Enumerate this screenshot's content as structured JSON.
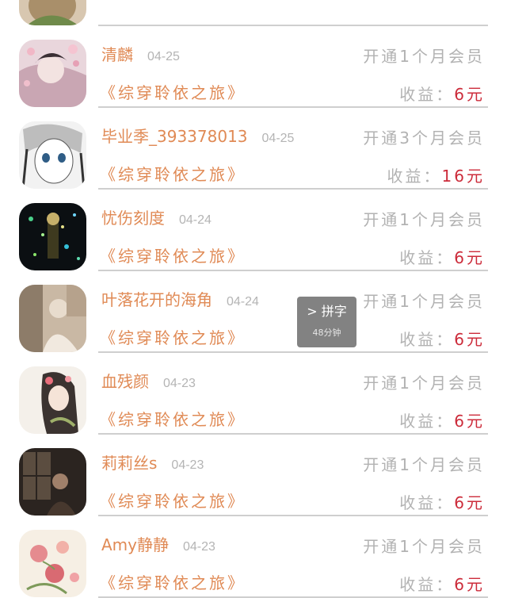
{
  "colors": {
    "name": "#e08a55",
    "date": "#b4b4b4",
    "muted": "#b2b2b2",
    "amount": "#cc2b3a",
    "divider": "#cfcfcf",
    "toast_bg": "#5f5f5f"
  },
  "records": [
    {
      "name": "",
      "date": "",
      "action": "",
      "book": "",
      "earning_label": "",
      "amount": "",
      "avatar": "avatar-girl-icon"
    },
    {
      "name": "清麟",
      "date": "04-25",
      "action": "开通1个月会员",
      "book": "《综穿聆依之旅》",
      "earning_label": "收益：",
      "amount": "6元",
      "avatar": "avatar-blossom-girl-icon"
    },
    {
      "name": "毕业季_393378013",
      "date": "04-25",
      "action": "开通3个月会员",
      "book": "《综穿聆依之旅》",
      "earning_label": "收益：",
      "amount": "16元",
      "avatar": "avatar-anime-sketch-icon"
    },
    {
      "name": "忧伤刻度",
      "date": "04-24",
      "action": "开通1个月会员",
      "book": "《综穿聆依之旅》",
      "earning_label": "收益：",
      "amount": "6元",
      "avatar": "avatar-sparkle-night-icon"
    },
    {
      "name": "叶落花开的海角",
      "date": "04-24",
      "action": "开通1个月会员",
      "book": "《综穿聆依之旅》",
      "earning_label": "收益：",
      "amount": "6元",
      "avatar": "avatar-sepia-photo-icon"
    },
    {
      "name": "血残颜",
      "date": "04-23",
      "action": "开通1个月会员",
      "book": "《综穿聆依之旅》",
      "earning_label": "收益：",
      "amount": "6元",
      "avatar": "avatar-flower-hair-girl-icon"
    },
    {
      "name": "莉莉丝s",
      "date": "04-23",
      "action": "开通1个月会员",
      "book": "《综穿聆依之旅》",
      "earning_label": "收益：",
      "amount": "6元",
      "avatar": "avatar-dark-window-icon"
    },
    {
      "name": "Amy静静",
      "date": "04-23",
      "action": "开通1个月会员",
      "book": "《综穿聆依之旅》",
      "earning_label": "收益：",
      "amount": "6元",
      "avatar": "avatar-peony-painting-icon"
    }
  ],
  "toast": {
    "label": "拼字",
    "sub": "48分钟",
    "icon": "chevron-right-icon"
  }
}
